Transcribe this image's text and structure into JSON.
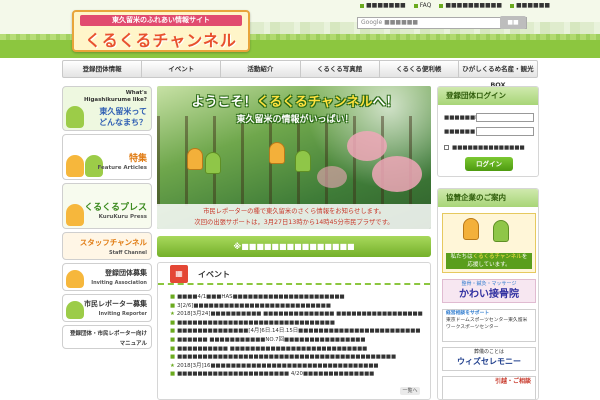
{
  "header": {
    "logo_subtitle": "東久留米のふれあい情報サイト",
    "logo_title": "くるくるチャンネル",
    "top_links": [
      "■■■■■■■",
      "FAQ",
      "■■■■■■■■■■",
      "■■■■■■"
    ],
    "search_placeholder": "Google ■■■■■■",
    "search_button": "■■"
  },
  "nav": {
    "items": [
      "登録団体情報",
      "イベント",
      "活動紹介",
      "くるくる写真館",
      "くるくる便利帳",
      "ひがしくるめ名産・観光BOX"
    ]
  },
  "left_sidebar": {
    "box1": {
      "line1": "What's",
      "line2": "Higashikurume like?",
      "line3": "東久留米って",
      "line4": "どんなまち？"
    },
    "box2": {
      "title": "特集",
      "sub": "Feature Articles"
    },
    "box3": {
      "title": "くるくるプレス",
      "sub": "KuruKuru Press"
    },
    "box4": {
      "title": "スタッフチャンネル",
      "sub": "Staff Channel"
    },
    "box5": {
      "title": "登録団体募集",
      "sub": "Inviting Association"
    },
    "box6": {
      "title": "市民レポーター募集",
      "sub": "Inviting Reporter"
    },
    "box7": {
      "title": "登録団体・市民レポーター向け",
      "sub": "マニュアル"
    }
  },
  "banner": {
    "title_pre": "ようこそ！",
    "title_hl": "くるくるチャンネル",
    "title_post": "へ！",
    "subtitle": "東久留米の情報がいっぱい！",
    "note1": "市民レポーターの種で東久留米のさくら情報をお知らせします。",
    "note2": "次回の出張サポートは，3月27日13時から14時45分市民プラザです。"
  },
  "announcement": "※■■■■■■■■■■■■■■■",
  "event": {
    "title": "イベント",
    "icon": "calendar-icon",
    "items": [
      "■■■■4/1■■■HAS■■■■■■■■■■■■■■■■■■■■■■",
      "3[2/6]■■■■■■■■■■■■■■■■■■■■■■■■■■■",
      "2018[3月24]■■■■■■■■■■ ■■■■■■■■■■■■■■ ■■■■■■■■■■■■■■■■■",
      "■■■■■■■■■■■■■■■■■■■■■■■■■■■■■■■",
      "■■■■■■■■■■■■■■[4月]6日.14日.15日■■■■■■■■■■■■■■■■■■■■■■■■",
      "■■■■■■ ■■■■■■■■■■■NO.7回■■■■■■■■■■■■■■■■",
      "■■■■■■■■■■ ■■■■■■■■■■■■■■■■■■■■■■■■■■■",
      "■■■■■■■■■■■■■■■■■■■■■■■■■■■■■■■■■■■■■■■■■■■",
      "2018[3月]16■■■■■■■■■■■■■■■■■■■■■■■■■■■■■■■■■",
      "■■■■■■■■■■■■■■■■■■■■■■ 4/20■■■■■■■■■■■■■■"
    ],
    "more": "一覧へ"
  },
  "login": {
    "title": "登録団体ログイン",
    "id_label": "■■■■■■ID",
    "pw_label": "■■■■■■",
    "remember": "■■■■■■■■■■■■■■",
    "button": "ログイン"
  },
  "sponsor": {
    "title": "協賛企業のご案内",
    "ad1_pre": "私たちは",
    "ad1_hl": "くるくるチャンネル",
    "ad1_post": "を",
    "ad1_line2": "応援しています。",
    "ad2_sub": "整骨・鍼灸・マッサージ",
    "ad2_name": "かわい接骨院",
    "ad3_line1": "経営相談をサポート",
    "ad3_line2": "東京ドームスポーツセンター東久留米",
    "ad3_line3": "ワークスポーツセンター",
    "ad4_sub": "葬儀のことは",
    "ad4_name": "ウィズセレモニー",
    "ad5": "引越・ご相談"
  },
  "colors": {
    "brand_green": "#8cc63f",
    "accent_red": "#e8512e",
    "link_blue": "#2f7ccf"
  }
}
